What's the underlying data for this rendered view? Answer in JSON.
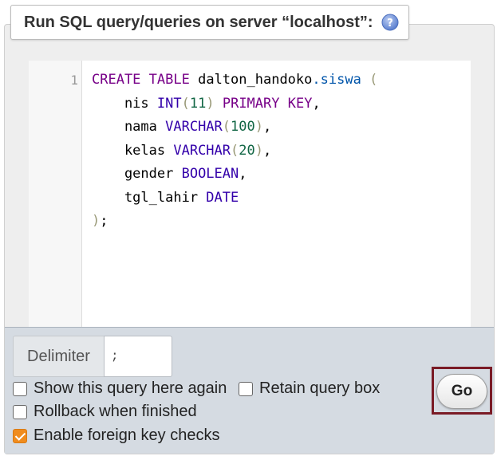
{
  "query_box": {
    "title": "Run SQL query/queries on server “localhost”:",
    "help_icon": "help-icon"
  },
  "editor": {
    "line_number": "1",
    "lines": [
      [
        {
          "t": "CREATE",
          "c": "kw"
        },
        {
          "t": " "
        },
        {
          "t": "TABLE",
          "c": "kw"
        },
        {
          "t": " dalton_handoko"
        },
        {
          "t": ".siswa",
          "c": "prop"
        },
        {
          "t": " "
        },
        {
          "t": "(",
          "c": "punct"
        }
      ],
      [
        {
          "t": "    nis "
        },
        {
          "t": "INT",
          "c": "dt"
        },
        {
          "t": "(",
          "c": "punct"
        },
        {
          "t": "11",
          "c": "num"
        },
        {
          "t": ")",
          "c": "punct"
        },
        {
          "t": " "
        },
        {
          "t": "PRIMARY",
          "c": "kw"
        },
        {
          "t": " "
        },
        {
          "t": "KEY",
          "c": "kw"
        },
        {
          "t": ","
        }
      ],
      [
        {
          "t": "    nama "
        },
        {
          "t": "VARCHAR",
          "c": "dt"
        },
        {
          "t": "(",
          "c": "punct"
        },
        {
          "t": "100",
          "c": "num"
        },
        {
          "t": ")",
          "c": "punct"
        },
        {
          "t": ","
        }
      ],
      [
        {
          "t": "    kelas "
        },
        {
          "t": "VARCHAR",
          "c": "dt"
        },
        {
          "t": "(",
          "c": "punct"
        },
        {
          "t": "20",
          "c": "num"
        },
        {
          "t": ")",
          "c": "punct"
        },
        {
          "t": ","
        }
      ],
      [
        {
          "t": "    gender "
        },
        {
          "t": "BOOLEAN",
          "c": "dt"
        },
        {
          "t": ","
        }
      ],
      [
        {
          "t": "    tgl_lahir "
        },
        {
          "t": "DATE",
          "c": "dt"
        }
      ],
      [
        {
          "t": ")",
          "c": "punct"
        },
        {
          "t": ";"
        }
      ]
    ]
  },
  "footer": {
    "delimiter_label": "Delimiter",
    "delimiter_value": ";",
    "options": {
      "show_query": {
        "label": "Show this query here again",
        "checked": false
      },
      "retain_box": {
        "label": "Retain query box",
        "checked": false
      },
      "rollback": {
        "label": "Rollback when finished",
        "checked": false
      },
      "foreign_keys": {
        "label": "Enable foreign key checks",
        "checked": true
      }
    },
    "go_label": "Go"
  },
  "colors": {
    "keyword": "#770088",
    "datatype": "#3300aa",
    "number": "#116644",
    "property": "#0055aa",
    "checkbox_checked": "#f08c1e",
    "highlight_frame": "#7a1b26"
  }
}
